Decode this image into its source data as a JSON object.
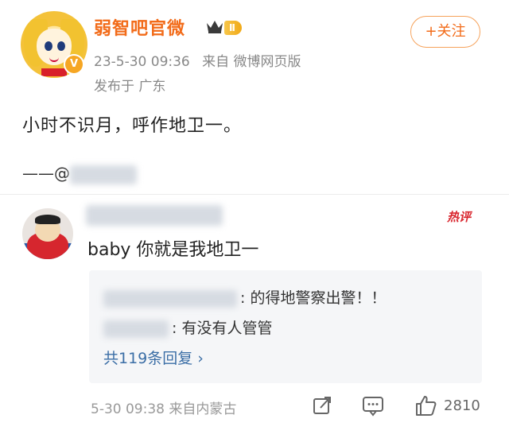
{
  "post": {
    "username": "弱智吧官微",
    "level_badge": "Ⅱ",
    "timestamp": "23-5-30 09:36",
    "source": "来自 微博网页版",
    "location": "发布于 广东",
    "follow_label": "+关注",
    "text": "小时不识月，呼作地卫一。",
    "mention_prefix": "——@"
  },
  "comment": {
    "hot_label": "热评",
    "text": "baby  你就是我地卫一",
    "replies": [
      {
        "text": ": 的得地警察出警！！"
      },
      {
        "text": ": 有没有人管管"
      }
    ],
    "more_replies": "共119条回复 ›",
    "time_source": "5-30 09:38  来自内蒙古",
    "like_count": "2810"
  },
  "colors": {
    "username": "#f26b19",
    "link": "#3b6ea6",
    "meta": "#888888",
    "hot": "#d9262e"
  }
}
